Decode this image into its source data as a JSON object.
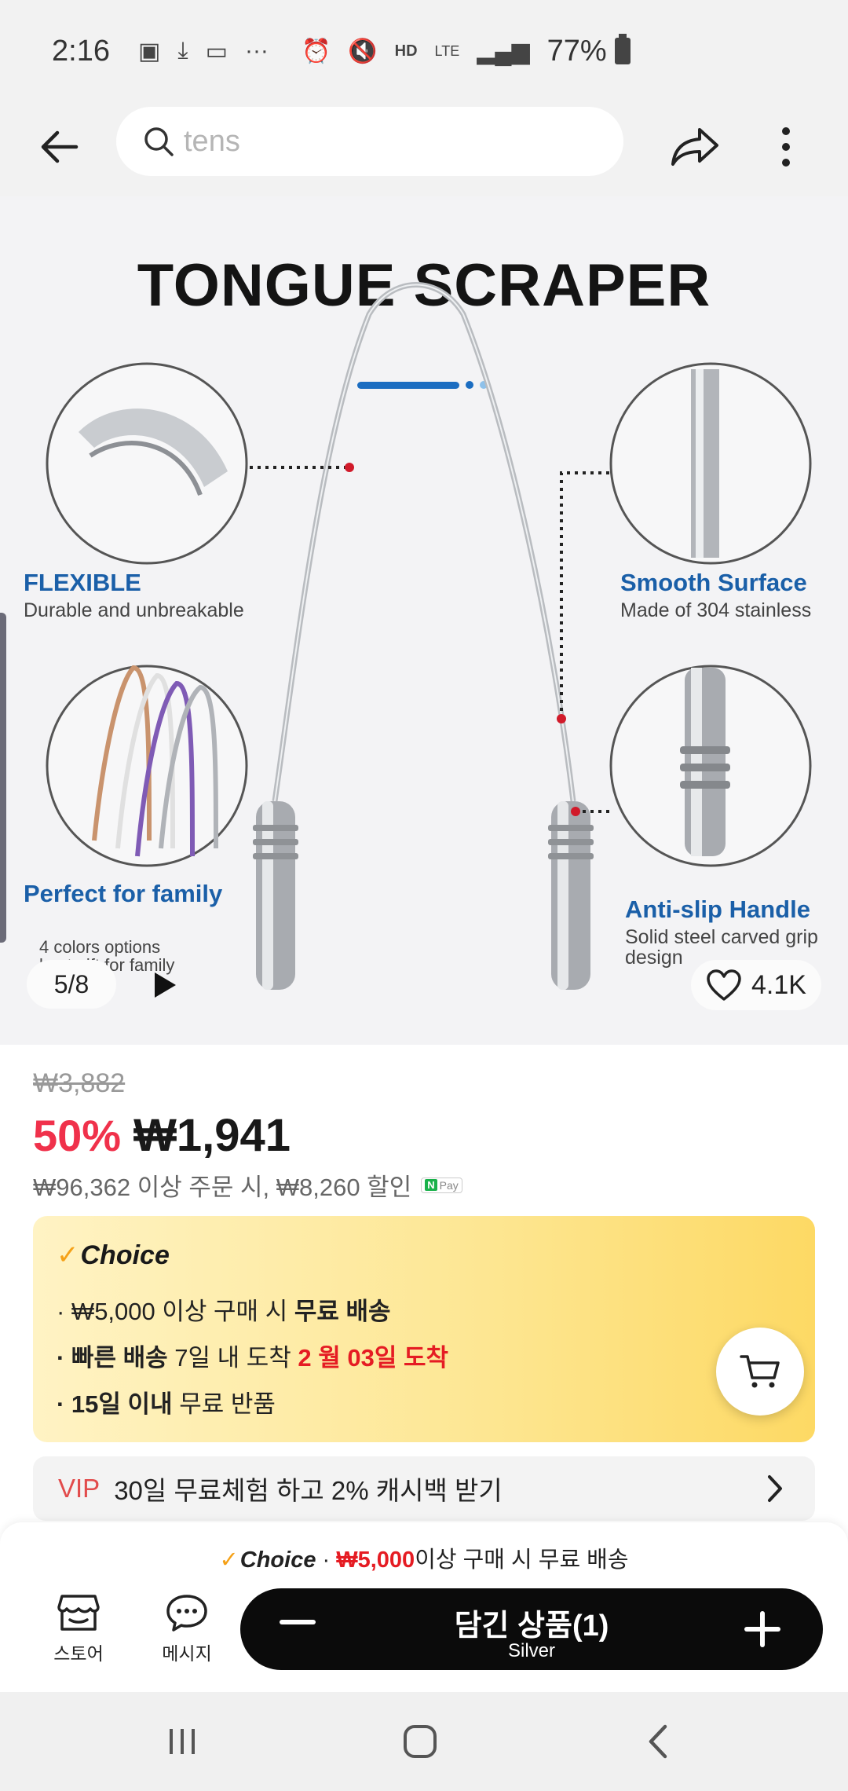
{
  "status_bar": {
    "time": "2:16",
    "network": "LTE",
    "battery": "77%"
  },
  "search": {
    "placeholder": "tens"
  },
  "product_image": {
    "title": "TONGUE SCRAPER",
    "features": [
      {
        "title": "FLEXIBLE",
        "subtitle": "Durable and unbreakable"
      },
      {
        "title": "Smooth Surface",
        "subtitle": "Made of 304 stainless"
      },
      {
        "title": "Perfect for family",
        "subtitle": "4 colors options\nbest gift for family"
      },
      {
        "title": "Anti-slip Handle",
        "subtitle": "Solid steel carved grip\ndesign"
      }
    ],
    "counter": "5/8",
    "likes": "4.1K"
  },
  "price": {
    "original": "₩3,882",
    "discount": "50%",
    "current": "₩1,941",
    "coupon": "₩96,362 이상 주문 시, ₩8,260 할인",
    "npay": "Pay"
  },
  "choice": {
    "logo": "Choice",
    "line1_pre": "· ₩5,000 이상 구매 시 ",
    "line1_bold": "무료 배송",
    "line2_bold": "· 빠른 배송",
    "line2_mid": " 7일 내 도착 ",
    "line2_red": "2 월 03일 도착",
    "line3_bold": "· 15일 이내",
    "line3_rest": "  무료 반품"
  },
  "vip": {
    "tag": "VIP",
    "text": "30일 무료체험 하고 2% 캐시백 받기"
  },
  "bottom": {
    "promo_choice": "Choice",
    "promo_sep": " · ",
    "promo_amount": "₩5,000",
    "promo_rest": "이상 구매 시 무료 배송",
    "store_label": "스토어",
    "message_label": "메시지",
    "cart_title": "담긴 상품(1)",
    "cart_variant": "Silver"
  },
  "colors": {
    "accent_red": "#f0314b",
    "feature_blue": "#1a5fa8",
    "choice_check": "#f5a117"
  }
}
